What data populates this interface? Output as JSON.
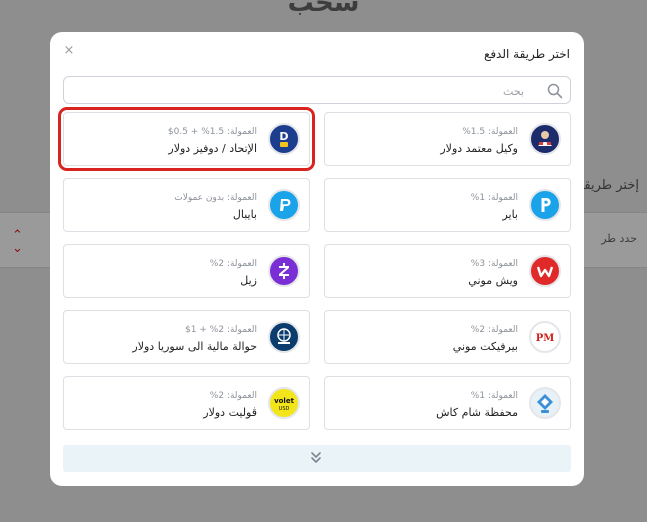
{
  "background": {
    "page_title": "سحب",
    "method_label": "إختر طريقة",
    "method_select_text": "حدد طر"
  },
  "modal": {
    "title": "اختر طريقة الدفع",
    "close_label": "×",
    "search": {
      "placeholder": "بحث",
      "value": ""
    },
    "methods": [
      {
        "fee": "العمولة: 1.5%",
        "name": "وكيل معتمد دولار",
        "icon": "agent-icon"
      },
      {
        "fee": "العمولة: 1.5% + 0.5$",
        "name": "الإتحاد / دوفيز دولار",
        "icon": "dovizz-icon"
      },
      {
        "fee": "العمولة: 1%",
        "name": "باير",
        "icon": "payeer-icon"
      },
      {
        "fee": "العمولة: بدون عمولات",
        "name": "بايبال",
        "icon": "paypal-icon"
      },
      {
        "fee": "العمولة: 3%",
        "name": "ويش موني",
        "icon": "wish-money-icon"
      },
      {
        "fee": "العمولة: 2%",
        "name": "زيل",
        "icon": "zelle-icon"
      },
      {
        "fee": "العمولة: 2%",
        "name": "بيرفيكت موني",
        "icon": "perfect-money-icon"
      },
      {
        "fee": "العمولة: 2% + 1$",
        "name": "حوالة مالية الى سوريا دولار",
        "icon": "syria-transfer-icon"
      },
      {
        "fee": "العمولة: 1%",
        "name": "محفظة شام كاش",
        "icon": "sham-cash-icon"
      },
      {
        "fee": "العمولة: 2%",
        "name": "ڤوليت دولار",
        "icon": "volet-icon"
      }
    ],
    "logo_text": {
      "perfect_money": "PM",
      "volet": "volet",
      "volet_sub": "USD"
    }
  },
  "colors": {
    "highlight": "#d9231f",
    "load_more_bg": "#eaf3f8",
    "paypal": "#1aa3e8",
    "payeer": "#1aa3e8",
    "zelle": "#7a2fd6",
    "wish": "#e02a2a",
    "volet": "#f2e51a"
  }
}
